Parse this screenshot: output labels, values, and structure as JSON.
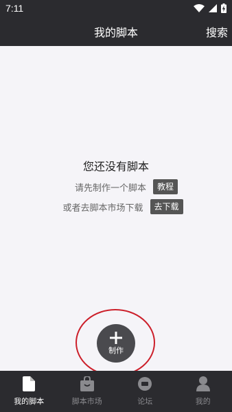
{
  "status_bar": {
    "time": "7:11"
  },
  "app_bar": {
    "title": "我的脚本",
    "search_label": "搜索"
  },
  "empty_state": {
    "title": "您还没有脚本",
    "hint_create": "请先制作一个脚本",
    "tutorial_button": "教程",
    "hint_download": "或者去脚本市场下载",
    "download_button": "去下载"
  },
  "fab": {
    "label": "制作",
    "icon": "plus-icon"
  },
  "bottom_nav": {
    "items": [
      {
        "label": "我的脚本",
        "icon": "file-icon",
        "active": true
      },
      {
        "label": "脚本市场",
        "icon": "shopping-bag-icon",
        "active": false
      },
      {
        "label": "论坛",
        "icon": "forum-icon",
        "active": false
      },
      {
        "label": "我的",
        "icon": "person-icon",
        "active": false
      }
    ]
  },
  "colors": {
    "bar_background": "#2b2b2f",
    "content_background": "#f5f4f8",
    "fab_background": "#4a4a4e",
    "annotation_red": "#cc1f2a"
  }
}
